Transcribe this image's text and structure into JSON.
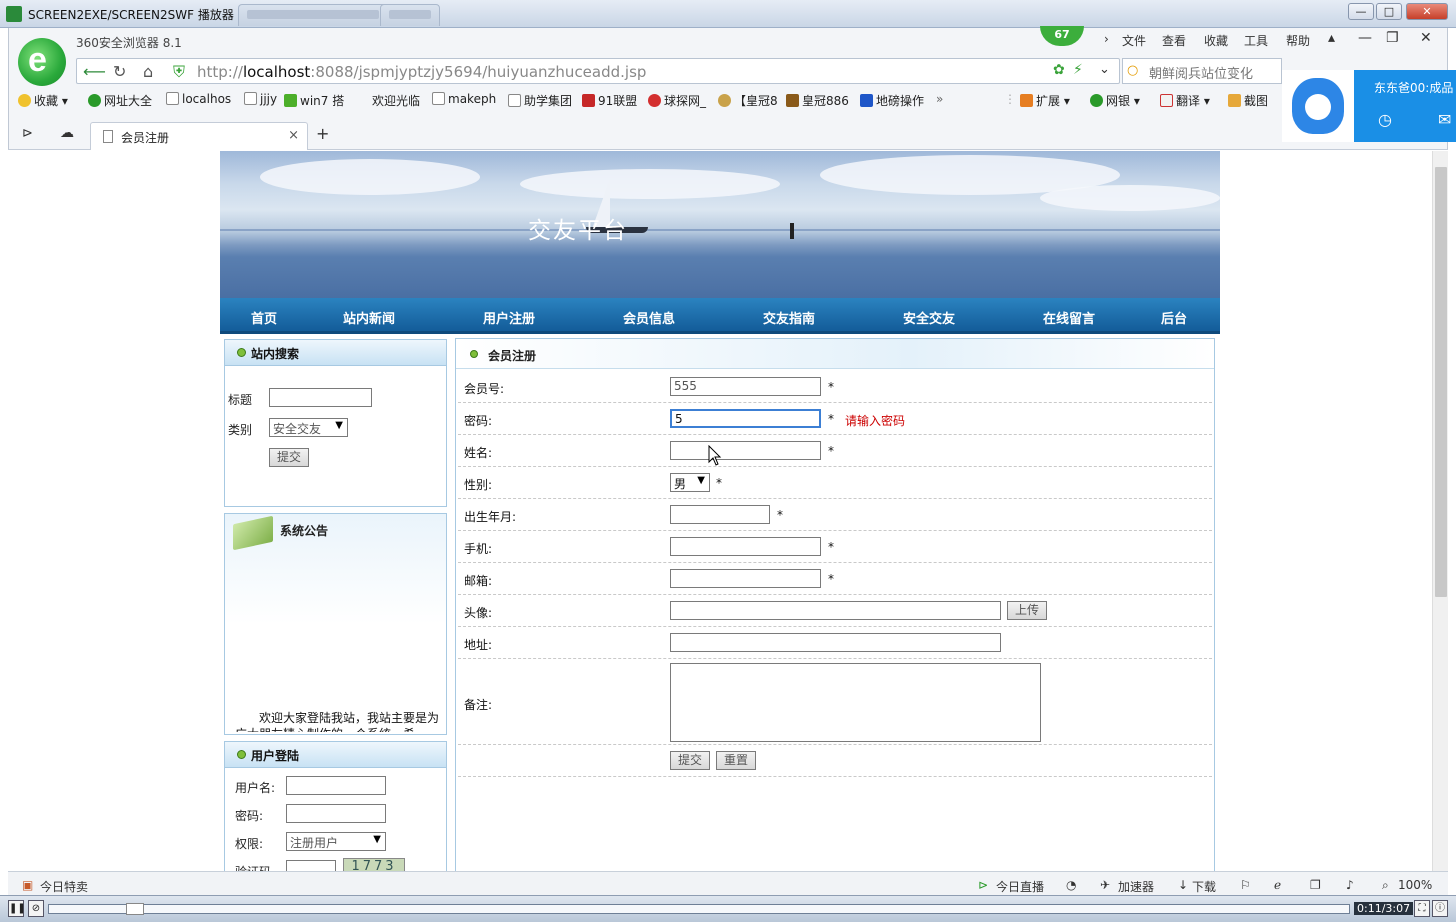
{
  "player": {
    "title": "SCREEN2EXE/SCREEN2SWF 播放器",
    "time": "0:11/3:07",
    "progress": 0.06
  },
  "browser": {
    "name": "360安全浏览器 8.1",
    "score": "67",
    "menu": [
      "文件",
      "查看",
      "收藏",
      "工具",
      "帮助"
    ],
    "url_prefix": "http://",
    "url_host": "localhost",
    "url_rest": ":8088/jspmjyptzjy5694/huiyuanzhuceadd.jsp",
    "search_hint": "朝鲜阅兵站位变化",
    "bookmarks": [
      "收藏",
      "网址大全",
      "localhos",
      "jjjy",
      "win7 搭",
      "欢迎光临",
      "makeph",
      "助学集团",
      "91联盟",
      "球探网_",
      "【皇冠8",
      "皇冠886",
      "地磅操作"
    ],
    "ext": [
      "扩展",
      "网银",
      "翻译",
      "截图"
    ],
    "tab_label": "会员注册",
    "popup_text": "东东爸00:成品",
    "status": {
      "left": "今日特卖",
      "live": "今日直播",
      "accel": "加速器",
      "download": "下载",
      "zoom": "100%"
    }
  },
  "site": {
    "banner_title": "交友平台",
    "nav": [
      "首页",
      "站内新闻",
      "用户注册",
      "会员信息",
      "交友指南",
      "安全交友",
      "在线留言",
      "后台"
    ],
    "search_panel": {
      "title": "站内搜索",
      "title_label": "标题",
      "category_label": "类别",
      "category_value": "安全交友",
      "submit": "提交"
    },
    "notice": {
      "title": "系统公告",
      "text": "欢迎大家登陆我站，我站主要是为广大朋友精心制作的一个系统，希"
    },
    "login": {
      "title": "用户登陆",
      "username_label": "用户名:",
      "password_label": "密码:",
      "role_label": "权限:",
      "role_value": "注册用户",
      "captcha_label": "验证码",
      "captcha": "1773"
    },
    "form": {
      "title": "会员注册",
      "member_id_label": "会员号:",
      "member_id_value": "555",
      "password_label": "密码:",
      "password_value": "5",
      "password_error": "请输入密码",
      "name_label": "姓名:",
      "gender_label": "性别:",
      "gender_value": "男",
      "birth_label": "出生年月:",
      "phone_label": "手机:",
      "email_label": "邮箱:",
      "avatar_label": "头像:",
      "upload": "上传",
      "address_label": "地址:",
      "remark_label": "备注:",
      "submit": "提交",
      "reset": "重置",
      "required": "*"
    }
  }
}
